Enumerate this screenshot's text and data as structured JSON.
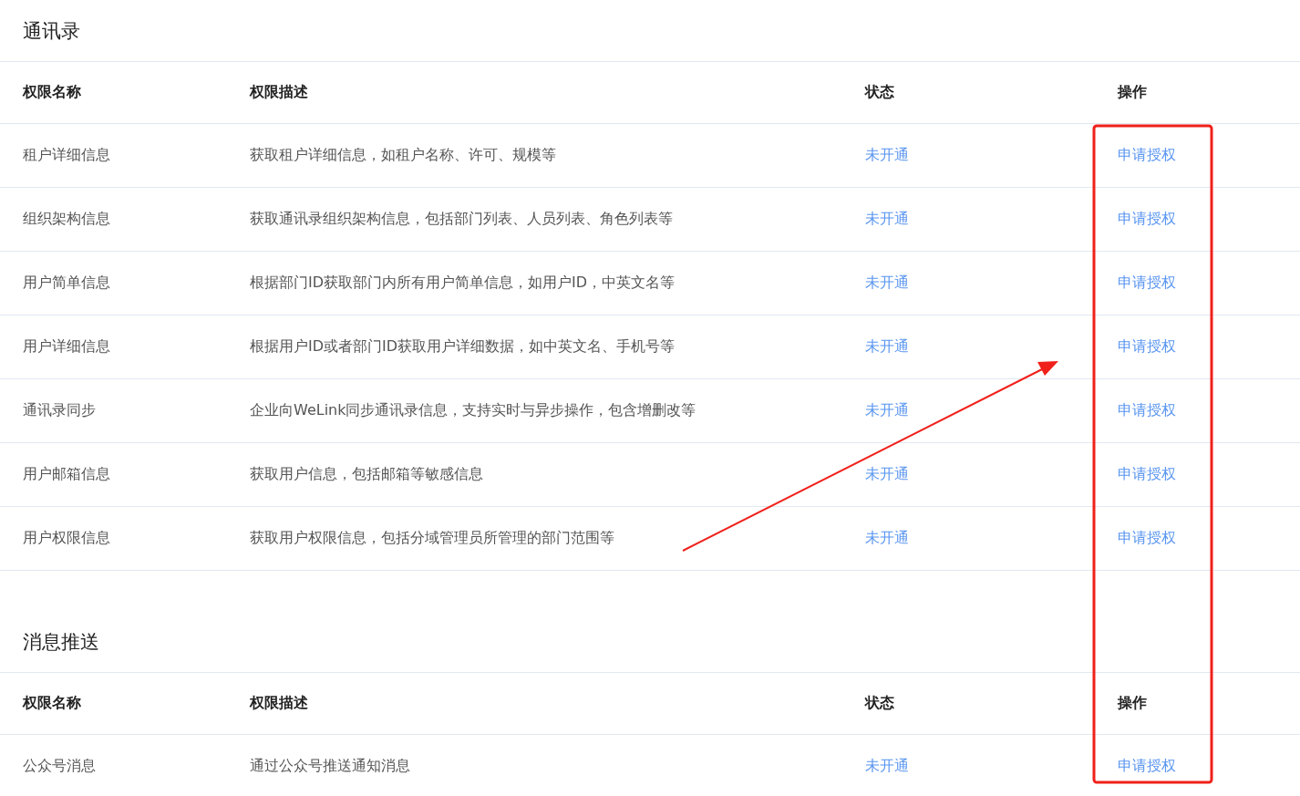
{
  "sections": [
    {
      "title": "通讯录",
      "columns": [
        "权限名称",
        "权限描述",
        "状态",
        "操作"
      ],
      "rows": [
        {
          "name": "租户详细信息",
          "description": "获取租户详细信息，如租户名称、许可、规模等",
          "status": "未开通",
          "action": "申请授权"
        },
        {
          "name": "组织架构信息",
          "description": "获取通讯录组织架构信息，包括部门列表、人员列表、角色列表等",
          "status": "未开通",
          "action": "申请授权"
        },
        {
          "name": "用户简单信息",
          "description": "根据部门ID获取部门内所有用户简单信息，如用户ID，中英文名等",
          "status": "未开通",
          "action": "申请授权"
        },
        {
          "name": "用户详细信息",
          "description": "根据用户ID或者部门ID获取用户详细数据，如中英文名、手机号等",
          "status": "未开通",
          "action": "申请授权"
        },
        {
          "name": "通讯录同步",
          "description": "企业向WeLink同步通讯录信息，支持实时与异步操作，包含增删改等",
          "status": "未开通",
          "action": "申请授权"
        },
        {
          "name": "用户邮箱信息",
          "description": "获取用户信息，包括邮箱等敏感信息",
          "status": "未开通",
          "action": "申请授权"
        },
        {
          "name": "用户权限信息",
          "description": "获取用户权限信息，包括分域管理员所管理的部门范围等",
          "status": "未开通",
          "action": "申请授权"
        }
      ]
    },
    {
      "title": "消息推送",
      "columns": [
        "权限名称",
        "权限描述",
        "状态",
        "操作"
      ],
      "rows": [
        {
          "name": "公众号消息",
          "description": "通过公众号推送通知消息",
          "status": "未开通",
          "action": "申请授权"
        }
      ]
    }
  ]
}
